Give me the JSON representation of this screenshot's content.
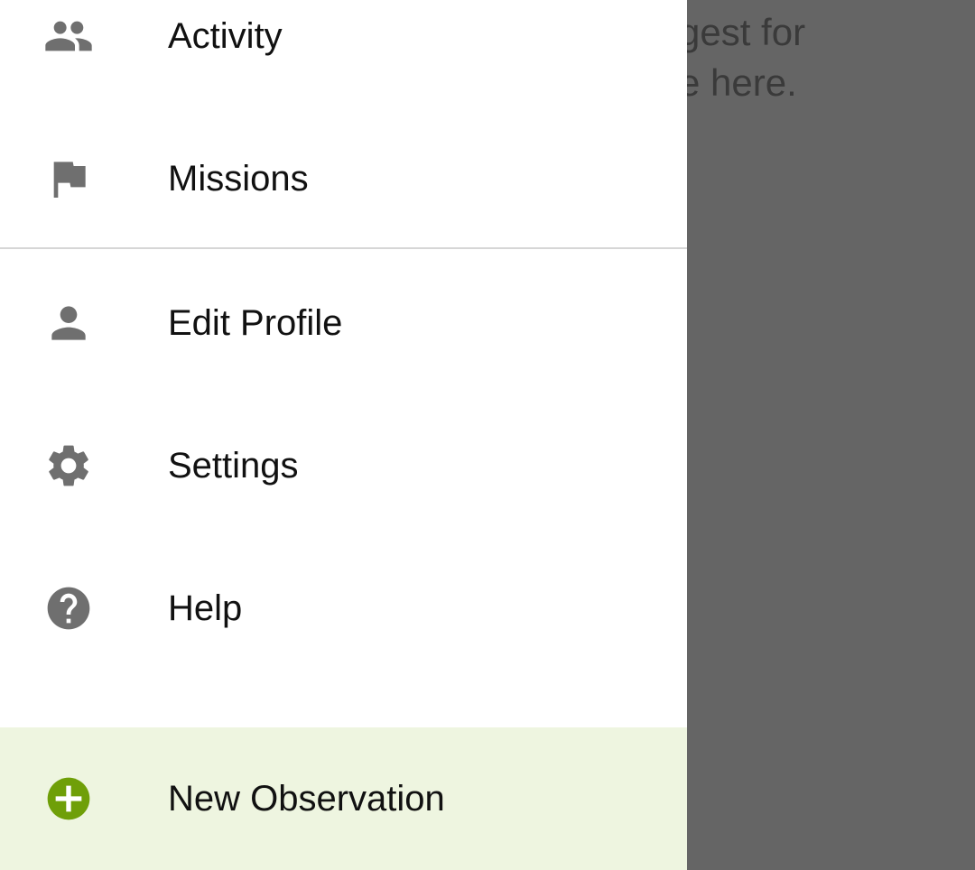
{
  "background": {
    "line1": "gest for",
    "line2": "e here."
  },
  "drawer": {
    "items": [
      {
        "label": "Activity",
        "icon": "people-icon"
      },
      {
        "label": "Missions",
        "icon": "flag-icon"
      },
      {
        "label": "Edit Profile",
        "icon": "person-icon"
      },
      {
        "label": "Settings",
        "icon": "gear-icon"
      },
      {
        "label": "Help",
        "icon": "help-icon"
      }
    ],
    "new_observation": {
      "label": "New Observation",
      "icon": "add-circle-icon"
    }
  },
  "colors": {
    "icon_gray": "#6f6f6f",
    "accent_green": "#6f9f08",
    "highlight_bg": "#eef5e0",
    "overlay": "#656565"
  }
}
